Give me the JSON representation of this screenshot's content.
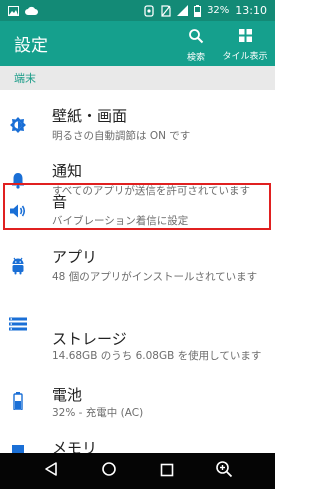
{
  "status_bar": {
    "battery": "32%",
    "time": "13:10",
    "icons": [
      "image-icon",
      "cloud-icon",
      "android-icon",
      "no-sim-icon",
      "signal-icon",
      "battery-icon"
    ]
  },
  "app_bar": {
    "title": "設定",
    "actions": [
      {
        "label": "検索",
        "icon": "search-icon"
      },
      {
        "label": "タイル表示",
        "icon": "grid-icon"
      }
    ]
  },
  "section": {
    "label": "端末"
  },
  "items": [
    {
      "title": "壁紙・画面",
      "subtitle": "明るさの自動調節は ON です",
      "icon": "brightness-icon"
    },
    {
      "title": "通知",
      "subtitle": "すべてのアプリが送信を許可されています",
      "icon": "bell-icon"
    },
    {
      "title": "音",
      "subtitle": "バイブレーション着信に設定",
      "icon": "speaker-icon"
    },
    {
      "title": "アプリ",
      "subtitle": "48 個のアプリがインストールされています",
      "icon": "android-icon"
    },
    {
      "title": "ストレージ",
      "subtitle": "14.68GB のうち 6.08GB を使用しています",
      "icon": "storage-icon"
    },
    {
      "title": "電池",
      "subtitle": "32% - 充電中 (AC)",
      "icon": "battery-icon"
    },
    {
      "title": "メモリ",
      "subtitle": "",
      "icon": "memory-icon"
    }
  ],
  "nav_bar": {
    "buttons": [
      "back-icon",
      "home-icon",
      "recents-icon",
      "zoom-icon"
    ]
  },
  "colors": {
    "status_bar": "#138a76",
    "app_bar": "#15a08d",
    "accent": "#1a6fd6",
    "highlight": "#e02020"
  }
}
